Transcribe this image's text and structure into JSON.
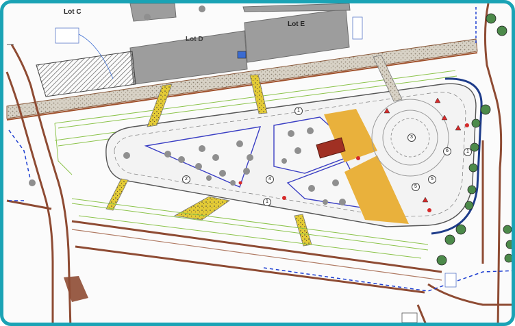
{
  "plan": {
    "lots": {
      "c": "Lot C",
      "d": "Lot D",
      "e": "Lot E"
    },
    "markers": [
      "1",
      "2",
      "3",
      "4",
      "5",
      "6"
    ],
    "colors": {
      "frame": "#1aa3b5",
      "sidewalk": "#8e4b33",
      "building": "#9c9c9c",
      "hatch": "#5a5a5a",
      "plaza": "#e9b13c",
      "kiosk": "#a03023",
      "planting": "#e0c53a",
      "island_outline": "#3b3fc4",
      "parking_green": "#8bc34a",
      "boundary": "#1e3fd1",
      "tree": "#8f8f8f"
    }
  }
}
